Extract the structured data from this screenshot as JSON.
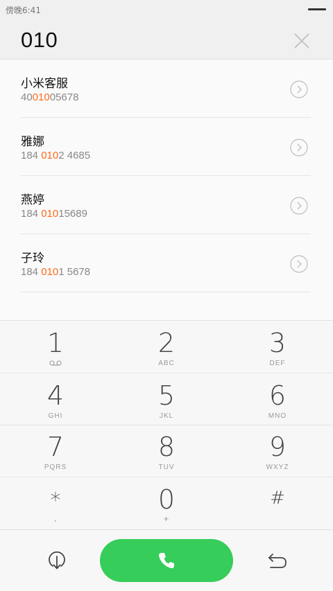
{
  "status_bar": {
    "time": "傍晚6:41"
  },
  "dialer": {
    "number": "010"
  },
  "contacts": [
    {
      "name": "小米客服",
      "num_pre": "40",
      "num_match": "010",
      "num_post": "05678"
    },
    {
      "name": "雅娜",
      "num_pre": "184 ",
      "num_match": "010",
      "num_post": "2 4685"
    },
    {
      "name": "燕婷",
      "num_pre": "184 ",
      "num_match": "010",
      "num_post": "15689"
    },
    {
      "name": "子玲",
      "num_pre": "184 ",
      "num_match": "010",
      "num_post": "1 5678"
    }
  ],
  "keypad": {
    "keys": [
      {
        "digit": "1",
        "sub": ""
      },
      {
        "digit": "2",
        "sub": "ABC"
      },
      {
        "digit": "3",
        "sub": "DEF"
      },
      {
        "digit": "4",
        "sub": "GHI"
      },
      {
        "digit": "5",
        "sub": "JKL"
      },
      {
        "digit": "6",
        "sub": "MNO"
      },
      {
        "digit": "7",
        "sub": "PQRS"
      },
      {
        "digit": "8",
        "sub": "TUV"
      },
      {
        "digit": "9",
        "sub": "WXYZ"
      },
      {
        "digit": "*",
        "sub": ","
      },
      {
        "digit": "0",
        "sub": "+"
      },
      {
        "digit": "#",
        "sub": ""
      }
    ]
  },
  "colors": {
    "call_green": "#36cd5a",
    "match_orange": "#ff6a1a"
  },
  "icons": {
    "key1_sub": "voicemail-icon",
    "clear": "close-icon",
    "contact_detail": "chevron-right-circle-icon",
    "call": "phone-icon",
    "hide_keypad": "arrow-down-circle-icon",
    "backspace": "undo-arrow-icon"
  }
}
